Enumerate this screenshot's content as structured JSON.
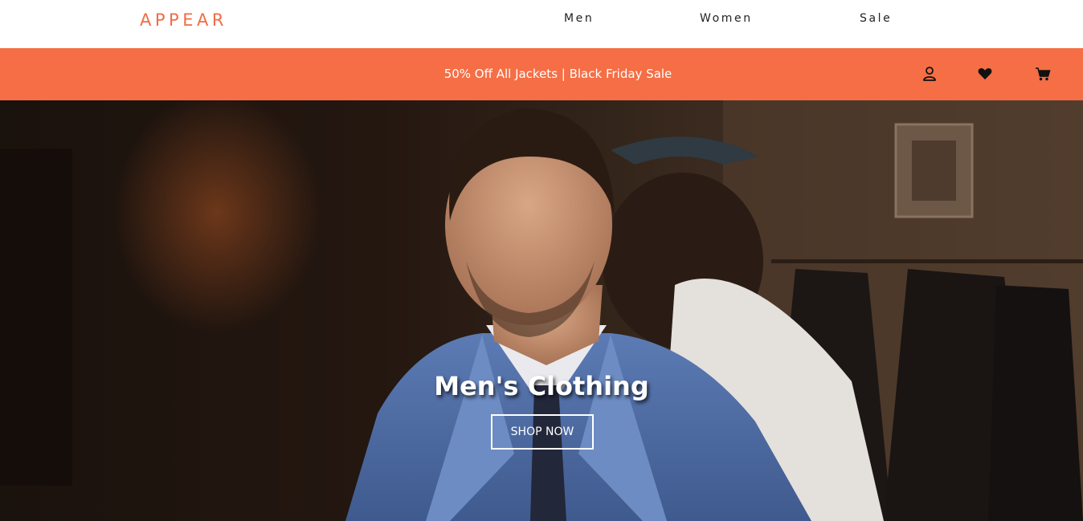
{
  "brand": {
    "name": "APPEAR",
    "color": "#f16c45"
  },
  "nav": {
    "men_label": "Men",
    "women_label": "Women",
    "sale_label": "Sale"
  },
  "promo": {
    "text": "50% Off All Jackets | Black Friday Sale",
    "background": "#f56e45"
  },
  "header_icons": [
    "user-icon",
    "heart-icon",
    "cart-icon"
  ],
  "hero": {
    "title": "Men's Clothing",
    "button_label": "SHOP NOW"
  }
}
